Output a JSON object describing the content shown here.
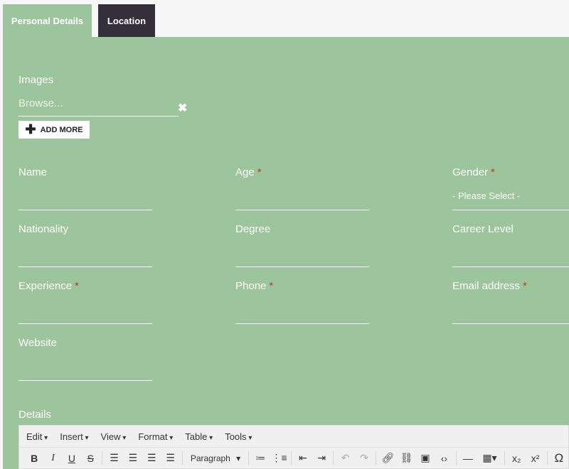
{
  "tabs": [
    {
      "label": "Personal Details",
      "active": true
    },
    {
      "label": "Location",
      "active": false
    }
  ],
  "images": {
    "label": "Images",
    "placeholder": "Browse...",
    "add_more": "ADD MORE"
  },
  "fields": [
    {
      "label": "Name",
      "required": false
    },
    {
      "label": "Age",
      "required": true
    },
    {
      "label": "Gender",
      "required": true,
      "value": "- Please Select -"
    },
    {
      "label": "Nationality",
      "required": false
    },
    {
      "label": "Degree",
      "required": false
    },
    {
      "label": "Career Level",
      "required": false
    },
    {
      "label": "Experience",
      "required": true
    },
    {
      "label": "Phone",
      "required": true
    },
    {
      "label": "Email address",
      "required": true
    },
    {
      "label": "Website",
      "required": false
    }
  ],
  "required_mark": "*",
  "details": {
    "label": "Details",
    "menu": [
      "Edit",
      "Insert",
      "View",
      "Format",
      "Table",
      "Tools"
    ],
    "block_format": "Paragraph"
  },
  "colors": {
    "panel": "#9dc59b",
    "active_tab_dark": "#352f3c",
    "required": "#c0392b"
  }
}
